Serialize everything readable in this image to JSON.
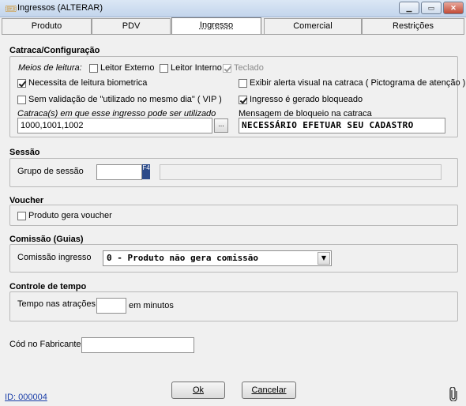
{
  "window": {
    "title": "Ingressos (ALTERAR)",
    "icon": "ticket-icon",
    "minimize_glyph": "▁",
    "maximize_glyph": "▭",
    "close_glyph": "✕"
  },
  "tabs": [
    {
      "label": "Produto"
    },
    {
      "label": "PDV"
    },
    {
      "label": "Ingresso",
      "active": true
    },
    {
      "label": "Comercial"
    },
    {
      "label": "Restrições"
    }
  ],
  "catraca": {
    "title": "Catraca/Configuração",
    "meios_label": "Meios de leitura:",
    "leitor_externo": {
      "label": "Leitor Externo",
      "checked": false
    },
    "leitor_interno": {
      "label": "Leitor Interno",
      "checked": false
    },
    "teclado": {
      "label": "Teclado",
      "checked": true,
      "disabled": true
    },
    "biometrica": {
      "label": "Necessita de leitura biometrica",
      "checked": true
    },
    "alerta_visual": {
      "label": "Exibir alerta visual na catraca ( Pictograma de atenção )",
      "checked": false
    },
    "sem_validacao": {
      "label": "Sem validação de \"utilizado no mesmo dia\" ( VIP )",
      "checked": false
    },
    "bloqueado": {
      "label": "Ingresso é gerado bloqueado",
      "checked": true
    },
    "catracas_label": "Catraca(s) em que esse ingresso pode ser utilizado",
    "catracas_value": "1000,1001,1002",
    "browse_label": "...",
    "mensagem_label": "Mensagem de bloqueio na catraca",
    "mensagem_value": "NECESSÁRIO EFETUAR SEU CADASTRO"
  },
  "sessao": {
    "title": "Sessão",
    "grupo_label": "Grupo de sessão",
    "grupo_value": "",
    "lookup_glyph": "F4",
    "descricao_value": ""
  },
  "voucher": {
    "title": "Voucher",
    "gera_voucher": {
      "label": "Produto gera voucher",
      "checked": false
    }
  },
  "comissao": {
    "title": "Comissão (Guias)",
    "label": "Comissão ingresso",
    "selected": "0 - Produto não gera comissão",
    "arrow_glyph": "▼"
  },
  "tempo": {
    "title": "Controle de tempo",
    "label": "Tempo nas atrações",
    "value": "",
    "unit": "em minutos"
  },
  "fabricante": {
    "label": "Cód no Fabricante",
    "value": ""
  },
  "buttons": {
    "ok": "Ok",
    "cancelar": "Cancelar"
  },
  "footer": {
    "id_text": "ID: 000004",
    "attachment_icon": "paperclip-icon"
  }
}
